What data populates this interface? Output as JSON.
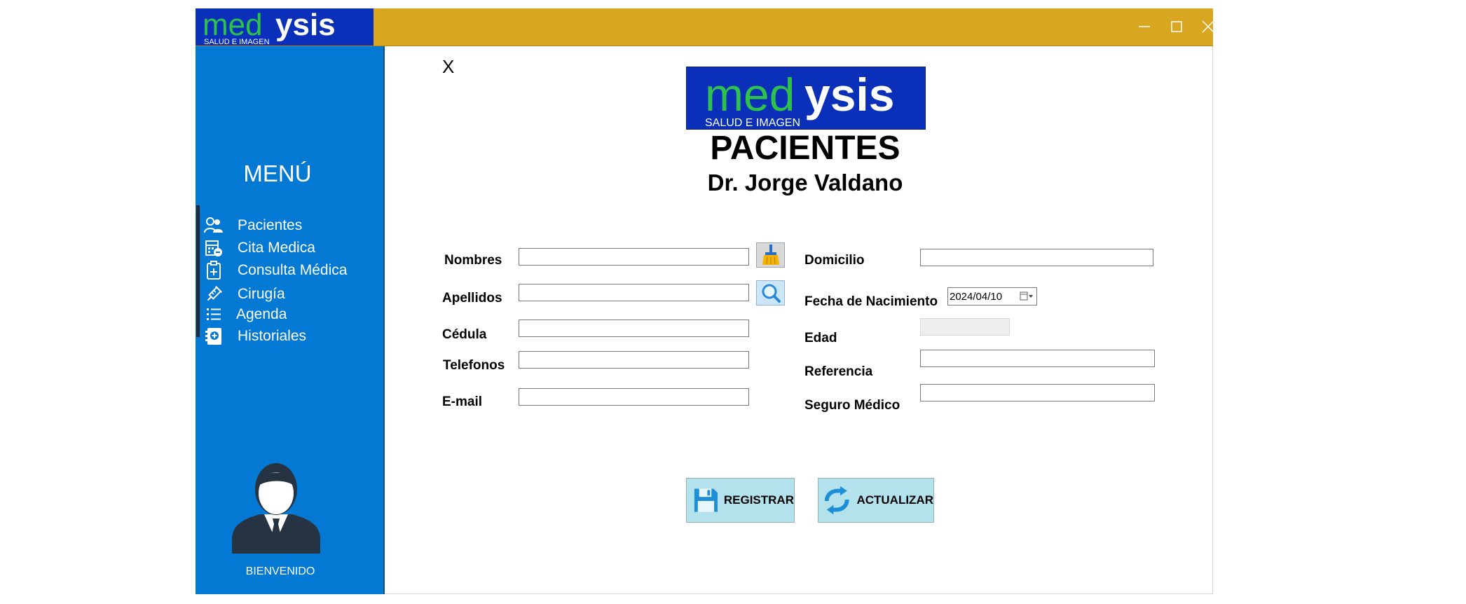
{
  "brand": {
    "logo_text_a": "med",
    "logo_text_b": "ysis",
    "logo_tagline": "SALUD E IMAGEN"
  },
  "colors": {
    "titlebar": "#d9a621",
    "sidebar": "#0379d3",
    "logo_bg": "#0a2fb8",
    "logo_green": "#2ec24d",
    "button_bg": "#b3e1ec"
  },
  "window_controls": {
    "minimize": "minimize-icon",
    "maximize": "maximize-icon",
    "close": "close-icon"
  },
  "sidebar": {
    "menu_title": "MENÚ",
    "items": [
      {
        "label": "Pacientes",
        "icon": "users-icon"
      },
      {
        "label": "Cita Medica",
        "icon": "calendar-calculator-icon"
      },
      {
        "label": "Consulta Médica",
        "icon": "clipboard-plus-icon"
      },
      {
        "label": "Cirugía",
        "icon": "syringe-icon"
      },
      {
        "label": "Agenda",
        "icon": "list-icon"
      },
      {
        "label": "Historiales",
        "icon": "medical-record-icon"
      }
    ],
    "welcome": "BIENVENIDO"
  },
  "content": {
    "close_label": "X",
    "title": "PACIENTES",
    "doctor": "Dr. Jorge Valdano"
  },
  "form": {
    "nombres": {
      "label": "Nombres",
      "value": ""
    },
    "apellidos": {
      "label": "Apellidos",
      "value": ""
    },
    "cedula": {
      "label": "Cédula",
      "value": ""
    },
    "telefonos": {
      "label": "Telefonos",
      "value": ""
    },
    "email": {
      "label": "E-mail",
      "value": ""
    },
    "domicilio": {
      "label": "Domicilio",
      "value": ""
    },
    "fecha_nacimiento": {
      "label": "Fecha de Nacimiento",
      "value": "2024/04/10"
    },
    "edad": {
      "label": "Edad",
      "value": ""
    },
    "referencia": {
      "label": "Referencia",
      "value": ""
    },
    "seguro_medico": {
      "label": "Seguro Médico",
      "value": ""
    },
    "clear_icon": "broom-icon",
    "search_icon": "magnifier-icon"
  },
  "actions": {
    "register": {
      "label": "REGISTRAR",
      "icon": "floppy-disk-icon"
    },
    "update": {
      "label": "ACTUALIZAR",
      "icon": "refresh-icon"
    }
  }
}
